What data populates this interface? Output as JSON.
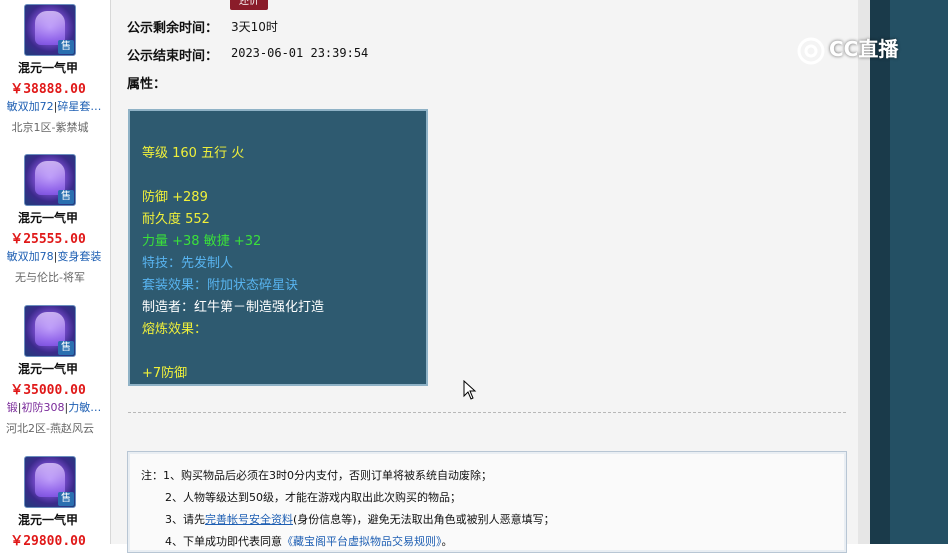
{
  "listing": [
    {
      "name": "混元一气甲",
      "price": "￥38888.00",
      "attrs": [
        "敏双加72",
        "碎星套…"
      ],
      "server": "北京1区-紫禁城",
      "badge": "售"
    },
    {
      "name": "混元一气甲",
      "price": "￥25555.00",
      "attrs": [
        "敏双加78",
        "变身套装"
      ],
      "server": "无与伦比-将军",
      "badge": "售"
    },
    {
      "name": "混元一气甲",
      "price": "￥35000.00",
      "attrs": [
        "锻",
        "初防308",
        "力敏…"
      ],
      "server": "河北2区-燕赵风云",
      "badge": "售"
    },
    {
      "name": "混元一气甲",
      "price": "￥29800.00",
      "badge": "售"
    }
  ],
  "top_button": "还价",
  "remaining": {
    "label": "公示剩余时间：",
    "value": "3天10时"
  },
  "end_time": {
    "label": "公示结束时间：",
    "value": "2023-06-01 23:39:54"
  },
  "attributes_label": "属性：",
  "attributes": {
    "level": "等级 160 五行 火",
    "defense": "防御 +289",
    "durability": "耐久度 552",
    "stats": "力量 +38 敏捷 +32",
    "skill": "特技：先发制人",
    "set_effect": "套装效果：附加状态碎星诀",
    "maker": "制造者：红牛第－制造强化打造",
    "refine": "熔炼效果：",
    "refine_value": "+7防御"
  },
  "notice": {
    "line1": "注：1、购买物品后必须在3时0分内支付，否则订单将被系统自动废除；",
    "line2": "2、人物等级达到50级，才能在游戏内取出此次购买的物品；",
    "line3_prefix": "3、请先",
    "line3_link": "完善帐号安全资料",
    "line3_suffix": "(身份信息等)，避免无法取出角色或被别人恶意填写；",
    "line4_prefix": "4、下单成功即代表同意",
    "line4_link": "《藏宝阁平台虚拟物品交易规则》",
    "line4_suffix": "。"
  },
  "watermark": "CC直播",
  "colors": {
    "price": "#e01818",
    "attr_box_bg": "#2e5a70",
    "accent_blue": "#1e5fb3"
  }
}
